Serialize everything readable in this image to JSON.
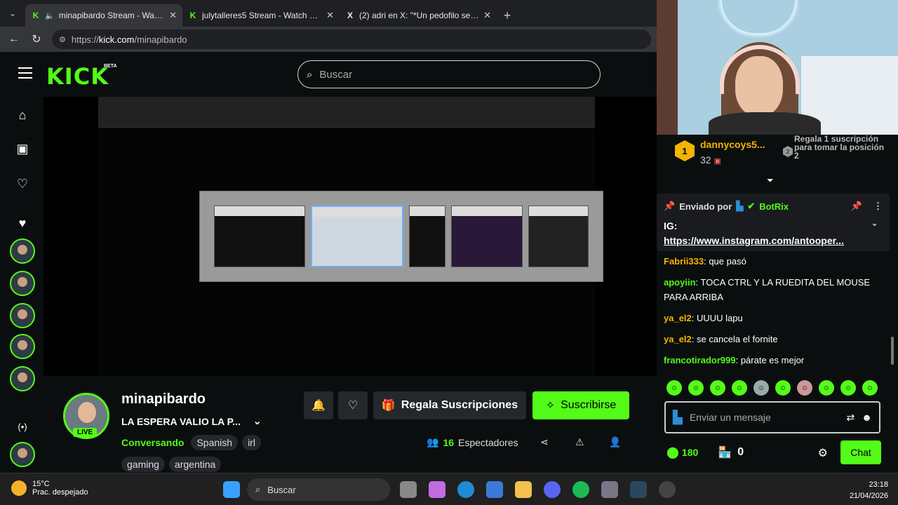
{
  "browser": {
    "tabs": [
      {
        "title": "minapibardo Stream - Watch",
        "icon": "kick-icon",
        "active": true
      },
      {
        "title": "julytalleres5 Stream - Watch Live c",
        "icon": "kick-icon",
        "active": false
      },
      {
        "title": "(2) adri en X: \"*Un pedofilo se me",
        "icon": "x-icon",
        "active": false
      }
    ],
    "url_prefix": "https://",
    "url_host": "kick.com",
    "url_path": "/minapibardo"
  },
  "header": {
    "logo": "KICK",
    "beta": "BETA",
    "search_placeholder": "Buscar"
  },
  "stream": {
    "channel": "minapibardo",
    "title": "LA ESPERA VALIO LA P...",
    "live": "LIVE",
    "category": "Conversando",
    "tags": [
      "Spanish",
      "irl"
    ],
    "tags2": [
      "gaming",
      "argentina"
    ],
    "gift_label": "Regala Suscripciones",
    "subscribe_label": "Suscribirse",
    "viewers_count": "16",
    "viewers_label": "Espectadores"
  },
  "chat": {
    "leader": {
      "rank": "1",
      "name": "dannycoys5...",
      "count": "32",
      "hint": "Regala 1 suscripción para tomar la posición 2",
      "rank2": "2"
    },
    "pinned": {
      "by_label": "Enviado por",
      "bot": "BotRix",
      "text": "IG:",
      "link": "https://www.instagram.com/antooper..."
    },
    "messages": [
      {
        "user": "Fabrii333",
        "color": "#f4b400",
        "text": "que pasó"
      },
      {
        "user": "apoyiin",
        "color": "#53fc18",
        "text": "TOCA CTRL Y LA RUEDITA DEL MOUSE PARA ARRIBA"
      },
      {
        "user": "ya_el2",
        "color": "#f4b400",
        "text": "UUUU lapu"
      },
      {
        "user": "ya_el2",
        "color": "#f4b400",
        "text": "se cancela el fornite"
      },
      {
        "user": "francotirador999",
        "color": "#53fc18",
        "text": "párate es mejor"
      }
    ],
    "input_placeholder": "Enviar un mensaje",
    "points": "180",
    "store_count": "0",
    "send_label": "Chat"
  },
  "taskbar": {
    "temp": "15°C",
    "weather": "Prac. despejado",
    "search": "Buscar",
    "time": "23:18",
    "date": "21/04/2026"
  }
}
